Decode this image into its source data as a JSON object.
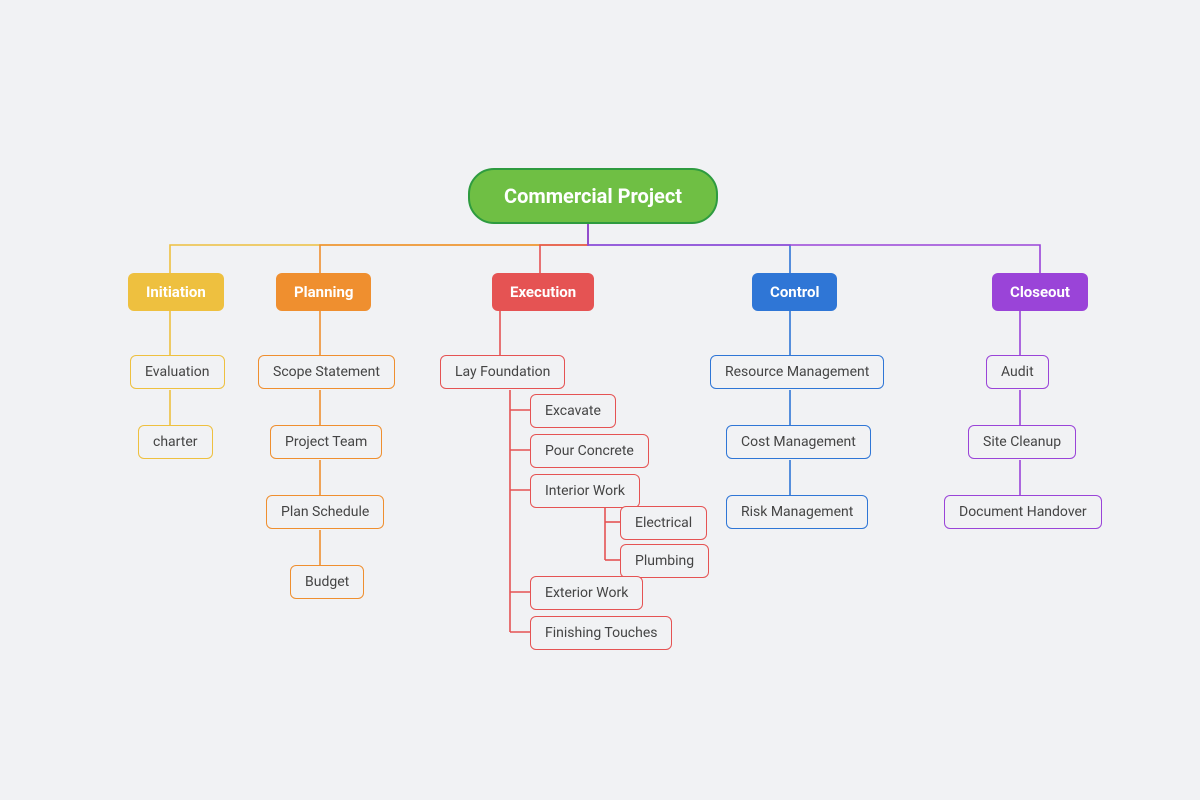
{
  "root": {
    "label": "Commercial Project",
    "fill": "#6fbf44",
    "stroke": "#2e9b3f"
  },
  "phases": [
    {
      "id": "initiation",
      "label": "Initiation",
      "fill": "#eec03f",
      "stroke": "#eec03f",
      "children": [
        {
          "label": "Evaluation"
        },
        {
          "label": "charter"
        }
      ]
    },
    {
      "id": "planning",
      "label": "Planning",
      "fill": "#ef8f2f",
      "stroke": "#ef8f2f",
      "children": [
        {
          "label": "Scope Statement"
        },
        {
          "label": "Project Team"
        },
        {
          "label": "Plan Schedule"
        },
        {
          "label": "Budget"
        }
      ]
    },
    {
      "id": "execution",
      "label": "Execution",
      "fill": "#e55353",
      "stroke": "#e55353",
      "children": [
        {
          "label": "Lay Foundation",
          "sub": [
            {
              "label": "Excavate"
            },
            {
              "label": "Pour Concrete"
            },
            {
              "label": "Interior Work",
              "sub": [
                {
                  "label": "Electrical"
                },
                {
                  "label": "Plumbing"
                }
              ]
            },
            {
              "label": "Exterior Work"
            },
            {
              "label": "Finishing Touches"
            }
          ]
        }
      ]
    },
    {
      "id": "control",
      "label": "Control",
      "fill": "#2f76d6",
      "stroke": "#2f76d6",
      "children": [
        {
          "label": "Resource Management"
        },
        {
          "label": "Cost Management"
        },
        {
          "label": "Risk Management"
        }
      ]
    },
    {
      "id": "closeout",
      "label": "Closeout",
      "fill": "#9a44d8",
      "stroke": "#9a44d8",
      "children": [
        {
          "label": "Audit"
        },
        {
          "label": "Site Cleanup"
        },
        {
          "label": "Document Handover"
        }
      ]
    }
  ],
  "chart_data": {
    "type": "tree",
    "title": "Commercial Project",
    "root": "Commercial Project",
    "branches": {
      "Initiation": [
        "Evaluation",
        "charter"
      ],
      "Planning": [
        "Scope Statement",
        "Project Team",
        "Plan Schedule",
        "Budget"
      ],
      "Execution": {
        "Lay Foundation": {
          "items": [
            "Excavate",
            "Pour Concrete",
            {
              "Interior Work": [
                "Electrical",
                "Plumbing"
              ]
            },
            "Exterior Work",
            "Finishing Touches"
          ]
        }
      },
      "Control": [
        "Resource Management",
        "Cost Management",
        "Risk Management"
      ],
      "Closeout": [
        "Audit",
        "Site Cleanup",
        "Document Handover"
      ]
    }
  }
}
